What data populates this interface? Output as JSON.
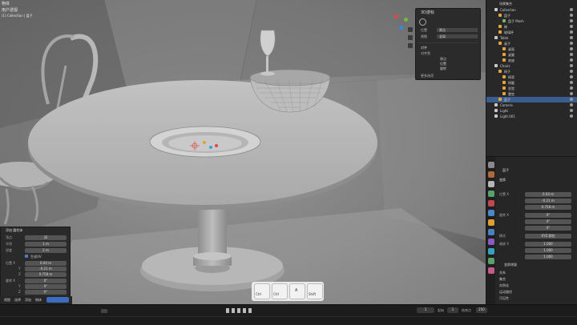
{
  "header": {
    "mode_label": "物体",
    "view_name": "用户透视",
    "collection_info": "(1) Collection | 盘子"
  },
  "gizmo": {
    "axes": [
      "X",
      "Y",
      "Z"
    ]
  },
  "n_panel": {
    "title": "3D游标",
    "location_label": "位置",
    "location_value": "原点",
    "view_label": "视图",
    "view_value": "全局",
    "align_title": "对齐",
    "align_to_label": "对齐到",
    "align_options": [
      "原点",
      "位置",
      "旋转"
    ],
    "extra_label": "更多选项"
  },
  "outliner": {
    "title": "场景集合",
    "items": [
      {
        "label": "Collection",
        "color": "#c9c9c9"
      },
      {
        "label": "盘子",
        "color": "#e8a33c"
      },
      {
        "label": "盘子 Mesh",
        "color": "#7ab55c"
      },
      {
        "label": "碗",
        "color": "#e8a33c"
      },
      {
        "label": "玻璃杯",
        "color": "#e8a33c"
      },
      {
        "label": "Table",
        "color": "#c9c9c9"
      },
      {
        "label": "桌子",
        "color": "#e8a33c"
      },
      {
        "label": "桌面",
        "color": "#e8a33c"
      },
      {
        "label": "桌腿",
        "color": "#e8a33c"
      },
      {
        "label": "底座",
        "color": "#e8a33c"
      },
      {
        "label": "Chairs",
        "color": "#c9c9c9"
      },
      {
        "label": "椅子",
        "color": "#e8a33c"
      },
      {
        "label": "椅背",
        "color": "#e8a33c"
      },
      {
        "label": "椅腿",
        "color": "#e8a33c"
      },
      {
        "label": "坐垫",
        "color": "#e8a33c"
      },
      {
        "label": "靠垫",
        "color": "#e8a33c"
      },
      {
        "label": "盘子",
        "color": "#e8a33c"
      },
      {
        "label": "Camera",
        "color": "#c9c9c9"
      },
      {
        "label": "Light",
        "color": "#c9c9c9"
      },
      {
        "label": "Light.001",
        "color": "#c9c9c9"
      }
    ]
  },
  "properties": {
    "object_name": "盘子",
    "section_transform": "变换",
    "location_label": "位置 X",
    "location_values": [
      "0.04 m",
      "-0.21 m",
      "0.758 m"
    ],
    "rotation_label": "旋转 X",
    "rotation_values": [
      "0°",
      "0°",
      "0°"
    ],
    "mode_label": "模式",
    "mode_value": "XYZ 欧拉",
    "scale_label": "缩放 X",
    "scale_values": [
      "1.000",
      "1.000",
      "1.000"
    ],
    "delta_label": "变换增量",
    "sections": [
      "关系",
      "集合",
      "实例化",
      "运动路径",
      "可见性",
      "视图显示"
    ]
  },
  "last_op_panel": {
    "title": "添加 圆柱体",
    "rows": [
      {
        "label": "顶点",
        "value": "32"
      },
      {
        "label": "半径",
        "value": "1 m"
      },
      {
        "label": "深度",
        "value": "2 m"
      }
    ],
    "check_label": "生成UV",
    "rows2": [
      {
        "label": "位置 X",
        "value": "0.04 m"
      },
      {
        "label": "Y",
        "value": "-0.21 m"
      },
      {
        "label": "Z",
        "value": "0.758 m"
      },
      {
        "label": "旋转 X",
        "value": "0°"
      },
      {
        "label": "Y",
        "value": "0°"
      },
      {
        "label": "Z",
        "value": "0°"
      }
    ]
  },
  "bottom_menu": [
    "视图",
    "选择",
    "添加",
    "物体"
  ],
  "status": {
    "frame": "1",
    "start_label": "起始",
    "start": "1",
    "end_label": "结束点",
    "end": "250"
  },
  "key_overlay": [
    {
      "key": "Ctrl",
      "sub": "Shift"
    },
    {
      "key": "Ctrl",
      "sub": ""
    },
    {
      "key": "A",
      "sub": ""
    },
    {
      "key": "Shift",
      "sub": "Ctrl"
    }
  ]
}
